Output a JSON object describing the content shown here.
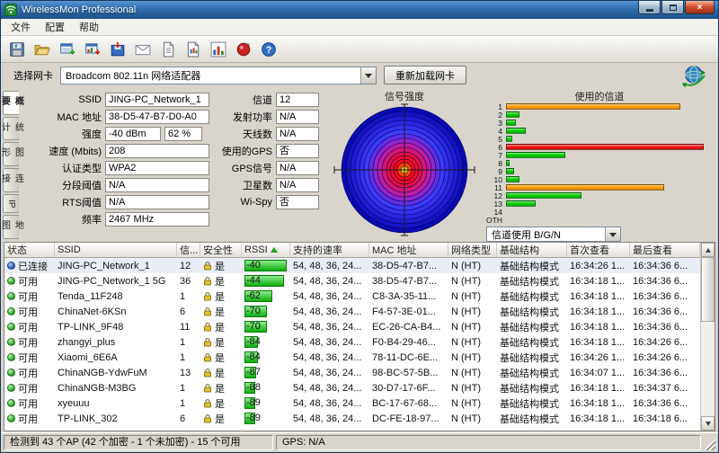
{
  "window": {
    "title": "WirelessMon Professional"
  },
  "menu": {
    "items": [
      {
        "id": "file",
        "label": "文件"
      },
      {
        "id": "config",
        "label": "配置"
      },
      {
        "id": "help",
        "label": "帮助"
      }
    ]
  },
  "toolbar": {
    "icons": [
      "save",
      "open",
      "save-networks",
      "save-graph",
      "export",
      "email",
      "report",
      "document",
      "chart",
      "gps",
      "help"
    ]
  },
  "adapter": {
    "label": "选择网卡",
    "selected": "Broadcom 802.11n 网络适配器",
    "reload_button": "重新加载网卡"
  },
  "side_tabs": [
    {
      "id": "summary",
      "label": "概要",
      "selected": true
    },
    {
      "id": "statistics",
      "label": "统计",
      "selected": false
    },
    {
      "id": "graphs",
      "label": "图形",
      "selected": false
    },
    {
      "id": "connect",
      "label": "连接",
      "selected": false
    },
    {
      "id": "ip",
      "label": "IP",
      "selected": false
    },
    {
      "id": "map",
      "label": "地图",
      "selected": false
    }
  ],
  "summary": {
    "left_fields": [
      {
        "label": "SSID",
        "values": [
          "JING-PC_Network_1"
        ]
      },
      {
        "label": "MAC 地址",
        "values": [
          "38-D5-47-B7-D0-A0"
        ]
      },
      {
        "label": "强度",
        "values": [
          "-40 dBm",
          "62 %"
        ]
      },
      {
        "label": "速度 (Mbits)",
        "values": [
          "208"
        ]
      },
      {
        "label": "认证类型",
        "values": [
          "WPA2"
        ]
      },
      {
        "label": "分段阈值",
        "values": [
          "N/A"
        ]
      },
      {
        "label": "RTS阈值",
        "values": [
          "N/A"
        ]
      },
      {
        "label": "频率",
        "values": [
          "2467 MHz"
        ]
      }
    ],
    "right_fields": [
      {
        "label": "信道",
        "values": [
          "12"
        ]
      },
      {
        "label": "发射功率",
        "values": [
          "N/A"
        ]
      },
      {
        "label": "天线数",
        "values": [
          "N/A"
        ]
      },
      {
        "label": "使用的GPS",
        "values": [
          "否"
        ]
      },
      {
        "label": "GPS信号",
        "values": [
          "N/A"
        ]
      },
      {
        "label": "卫星数",
        "values": [
          "N/A"
        ]
      },
      {
        "label": "Wi-Spy",
        "values": [
          "否"
        ]
      }
    ]
  },
  "signal_panel": {
    "title": "信号强度",
    "strength_dbm": "-40 dBm",
    "strength_pct": "62 %"
  },
  "chart_data": {
    "type": "bar",
    "orientation": "horizontal",
    "title": "使用的信道",
    "categories": [
      "1",
      "2",
      "3",
      "4",
      "5",
      "6",
      "7",
      "8",
      "9",
      "10",
      "11",
      "12",
      "13",
      "14",
      "OTH"
    ],
    "values": [
      88,
      7,
      5,
      10,
      3,
      100,
      30,
      2,
      4,
      7,
      80,
      38,
      15,
      0,
      0
    ],
    "colors": [
      "#ff9a00",
      "#00cc00",
      "#00cc00",
      "#00cc00",
      "#00cc00",
      "#ee1111",
      "#00cc00",
      "#00cc00",
      "#00cc00",
      "#00cc00",
      "#ff9a00",
      "#00cc00",
      "#00cc00",
      "#00cc00",
      "#00cc00"
    ],
    "xlim": [
      0,
      100
    ],
    "selector_value": "信道使用 B/G/N"
  },
  "ap_table": {
    "headers": [
      "状态",
      "SSID",
      "信...",
      "安全性",
      "RSSI",
      "支持的速率",
      "MAC 地址",
      "网络类型",
      "基础结构",
      "首次查看",
      "最后查看"
    ],
    "header_ids": [
      "status",
      "ssid",
      "channel",
      "security",
      "rssi",
      "rates",
      "mac",
      "net-type",
      "infrastructure",
      "first-seen",
      "last-seen"
    ],
    "sorted_by": "RSSI",
    "rows": [
      {
        "state": "connected",
        "status": "已连接",
        "ssid": "JING-PC_Network_1",
        "channel": "12",
        "security": "是",
        "rssi": -40,
        "rates": "54, 48, 36, 24...",
        "mac": "38-D5-47-B7...",
        "net_type": "N (HT)",
        "infrastructure": "基础结构模式",
        "first_seen": "16:34:26 1...",
        "last_seen": "16:34:36 6..."
      },
      {
        "state": "available",
        "status": "可用",
        "ssid": "JING-PC_Network_1 5G",
        "channel": "36",
        "security": "是",
        "rssi": -44,
        "rates": "54, 48, 36, 24...",
        "mac": "38-D5-47-B7...",
        "net_type": "N (HT)",
        "infrastructure": "基础结构模式",
        "first_seen": "16:34:18 1...",
        "last_seen": "16:34:36 6..."
      },
      {
        "state": "available",
        "status": "可用",
        "ssid": "Tenda_11F248",
        "channel": "1",
        "security": "是",
        "rssi": -62,
        "rates": "54, 48, 36, 24...",
        "mac": "C8-3A-35-11...",
        "net_type": "N (HT)",
        "infrastructure": "基础结构模式",
        "first_seen": "16:34:18 1...",
        "last_seen": "16:34:36 6..."
      },
      {
        "state": "available",
        "status": "可用",
        "ssid": "ChinaNet-6KSn",
        "channel": "6",
        "security": "是",
        "rssi": -70,
        "rates": "54, 48, 36, 24...",
        "mac": "F4-57-3E-01...",
        "net_type": "N (HT)",
        "infrastructure": "基础结构模式",
        "first_seen": "16:34:18 1...",
        "last_seen": "16:34:36 6..."
      },
      {
        "state": "available",
        "status": "可用",
        "ssid": "TP-LINK_9F48",
        "channel": "11",
        "security": "是",
        "rssi": -70,
        "rates": "54, 48, 36, 24...",
        "mac": "EC-26-CA-B4...",
        "net_type": "N (HT)",
        "infrastructure": "基础结构模式",
        "first_seen": "16:34:18 1...",
        "last_seen": "16:34:36 6..."
      },
      {
        "state": "available",
        "status": "可用",
        "ssid": "zhangyi_plus",
        "channel": "1",
        "security": "是",
        "rssi": -84,
        "rates": "54, 48, 36, 24...",
        "mac": "F0-B4-29-46...",
        "net_type": "N (HT)",
        "infrastructure": "基础结构模式",
        "first_seen": "16:34:18 1...",
        "last_seen": "16:34:26 6..."
      },
      {
        "state": "available",
        "status": "可用",
        "ssid": "Xiaomi_6E6A",
        "channel": "1",
        "security": "是",
        "rssi": -84,
        "rates": "54, 48, 36, 24...",
        "mac": "78-11-DC-6E...",
        "net_type": "N (HT)",
        "infrastructure": "基础结构模式",
        "first_seen": "16:34:26 1...",
        "last_seen": "16:34:26 6..."
      },
      {
        "state": "available",
        "status": "可用",
        "ssid": "ChinaNGB-YdwFuM",
        "channel": "13",
        "security": "是",
        "rssi": -87,
        "rates": "54, 48, 36, 24...",
        "mac": "98-BC-57-5B...",
        "net_type": "N (HT)",
        "infrastructure": "基础结构模式",
        "first_seen": "16:34:07 1...",
        "last_seen": "16:34:36 6..."
      },
      {
        "state": "available",
        "status": "可用",
        "ssid": "ChinaNGB-M3BG",
        "channel": "1",
        "security": "是",
        "rssi": -88,
        "rates": "54, 48, 36, 24...",
        "mac": "30-D7-17-6F...",
        "net_type": "N (HT)",
        "infrastructure": "基础结构模式",
        "first_seen": "16:34:18 1...",
        "last_seen": "16:34:37 6..."
      },
      {
        "state": "available",
        "status": "可用",
        "ssid": "xyeuuu",
        "channel": "1",
        "security": "是",
        "rssi": -89,
        "rates": "54, 48, 36, 24...",
        "mac": "BC-17-67-68...",
        "net_type": "N (HT)",
        "infrastructure": "基础结构模式",
        "first_seen": "16:34:18 1...",
        "last_seen": "16:34:36 6..."
      },
      {
        "state": "available",
        "status": "可用",
        "ssid": "TP-LINK_302",
        "channel": "6",
        "security": "是",
        "rssi": -89,
        "rates": "54, 48, 36, 24...",
        "mac": "DC-FE-18-97...",
        "net_type": "N (HT)",
        "infrastructure": "基础结构模式",
        "first_seen": "16:34:18 1...",
        "last_seen": "16:34:18 6..."
      }
    ]
  },
  "status_bar": {
    "summary": "检测到 43 个AP (42 个加密 - 1 个未加密) - 15 个可用",
    "gps": "GPS: N/A"
  }
}
